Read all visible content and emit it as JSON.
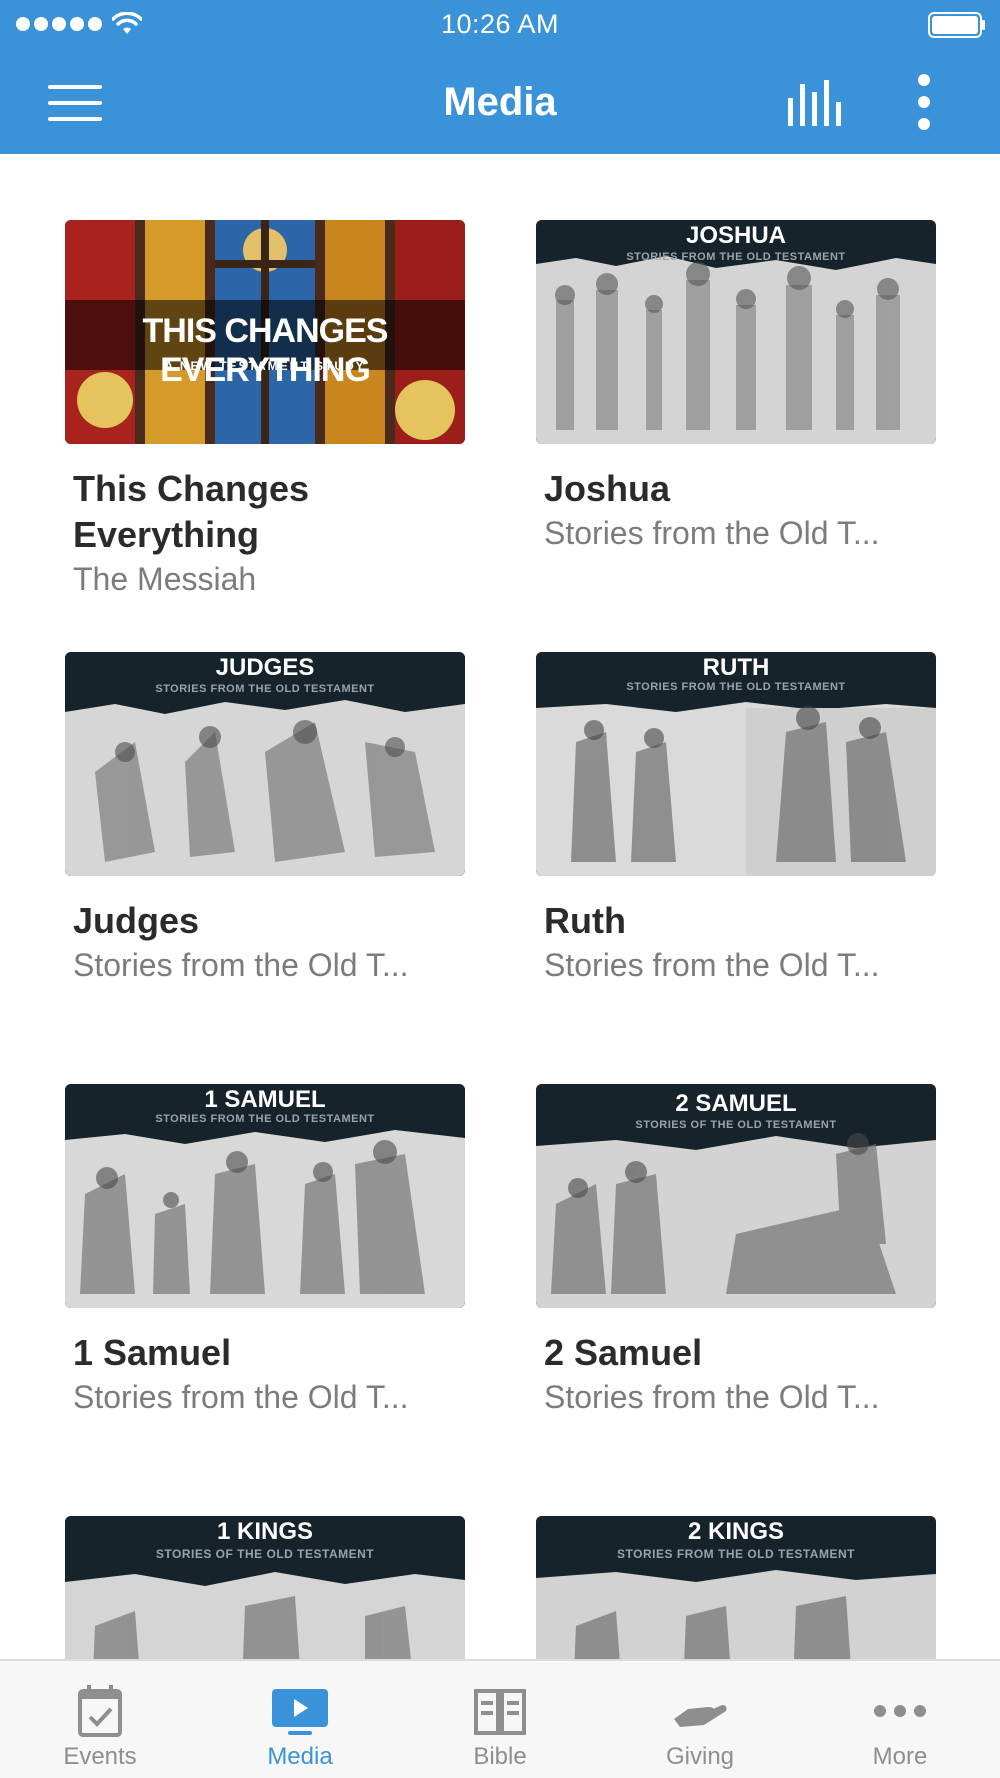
{
  "status_bar": {
    "time": "10:26 AM"
  },
  "nav": {
    "title": "Media"
  },
  "colors": {
    "brand": "#3a93d8",
    "tab_inactive": "#8e8e8e",
    "thumb_dark": "#17232b"
  },
  "items": [
    {
      "title": "This Changes Everything",
      "subtitle": "The Messiah",
      "banner": "THIS CHANGES EVERYTHING",
      "banner_sub": "A NEW TESTAMENT STUDY"
    },
    {
      "title": "Joshua",
      "subtitle": "Stories from the Old T...",
      "banner": "JOSHUA",
      "banner_sub": "STORIES FROM THE OLD TESTAMENT"
    },
    {
      "title": "Judges",
      "subtitle": "Stories from the Old T...",
      "banner": "JUDGES",
      "banner_sub": "STORIES FROM THE OLD TESTAMENT"
    },
    {
      "title": "Ruth",
      "subtitle": "Stories from the Old T...",
      "banner": "RUTH",
      "banner_sub": "STORIES FROM THE OLD TESTAMENT"
    },
    {
      "title": "1 Samuel",
      "subtitle": "Stories from the Old T...",
      "banner": "1 SAMUEL",
      "banner_sub": "STORIES FROM THE OLD TESTAMENT"
    },
    {
      "title": "2 Samuel",
      "subtitle": "Stories from the Old T...",
      "banner": "2 SAMUEL",
      "banner_sub": "STORIES OF THE OLD TESTAMENT"
    },
    {
      "banner": "1 KINGS",
      "banner_sub": "STORIES OF THE OLD TESTAMENT"
    },
    {
      "banner": "2 KINGS",
      "banner_sub": "STORIES FROM THE OLD TESTAMENT"
    }
  ],
  "tabs": [
    {
      "label": "Events",
      "icon": "calendar-check-icon",
      "active": false
    },
    {
      "label": "Media",
      "icon": "play-screen-icon",
      "active": true
    },
    {
      "label": "Bible",
      "icon": "open-book-icon",
      "active": false
    },
    {
      "label": "Giving",
      "icon": "hand-giving-icon",
      "active": false
    },
    {
      "label": "More",
      "icon": "more-dots-icon",
      "active": false
    }
  ]
}
